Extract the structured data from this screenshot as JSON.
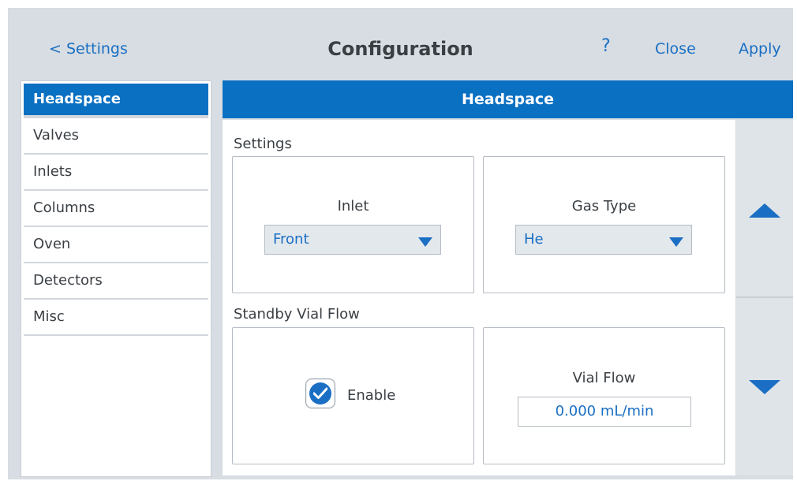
{
  "header": {
    "back_label": "< Settings",
    "title": "Configuration",
    "help_label": "?",
    "close_label": "Close",
    "apply_label": "Apply"
  },
  "sidebar": {
    "items": [
      {
        "label": "Headspace",
        "active": true
      },
      {
        "label": "Valves"
      },
      {
        "label": "Inlets"
      },
      {
        "label": "Columns"
      },
      {
        "label": "Oven"
      },
      {
        "label": "Detectors"
      },
      {
        "label": "Misc"
      }
    ]
  },
  "panel": {
    "title": "Headspace",
    "settings": {
      "section_label": "Settings",
      "inlet": {
        "label": "Inlet",
        "value": "Front"
      },
      "gas_type": {
        "label": "Gas Type",
        "value": "He"
      }
    },
    "standby": {
      "section_label": "Standby Vial Flow",
      "enable": {
        "label": "Enable",
        "checked": true
      },
      "vial_flow": {
        "label": "Vial Flow",
        "value": "0.000 mL/min"
      }
    }
  },
  "icons": {
    "scroll_up": "arrow-up-icon",
    "scroll_down": "arrow-down-icon",
    "dropdown": "caret-down-icon",
    "checkbox": "check-icon"
  },
  "colors": {
    "accent": "#0a70c2",
    "link": "#1a6fc4",
    "background": "#d7dde2"
  }
}
